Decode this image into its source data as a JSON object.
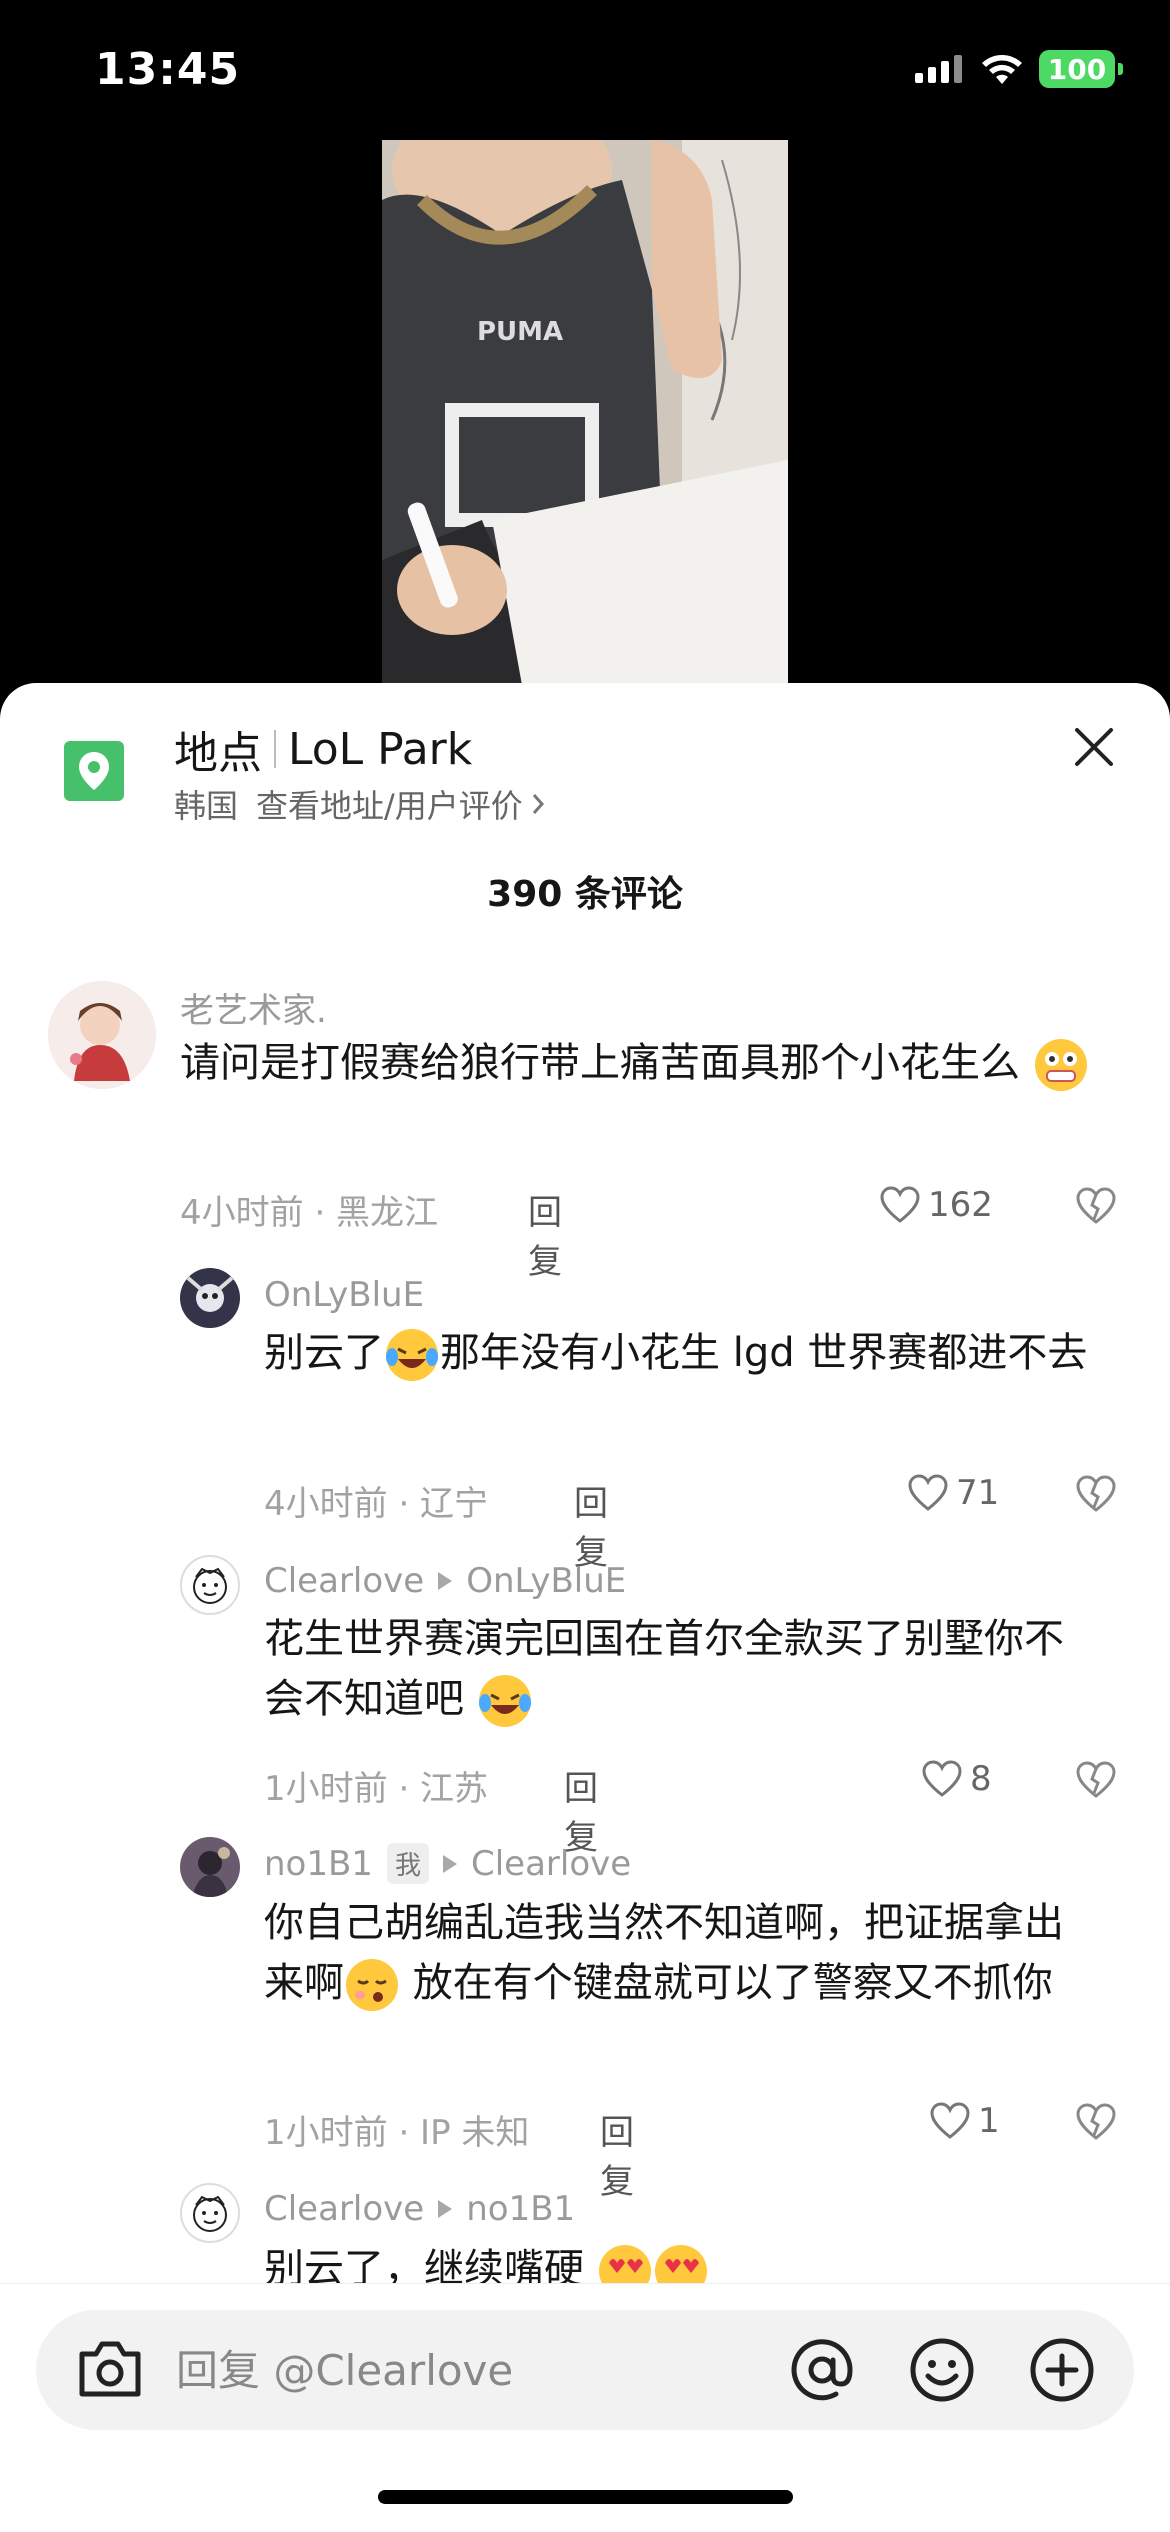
{
  "status_bar": {
    "time": "13:45",
    "battery": "100"
  },
  "location": {
    "label": "地点",
    "name": "LoL Park",
    "country": "韩国",
    "details_link": "查看地址/用户评价"
  },
  "comment_count": "390 条评论",
  "comments": [
    {
      "user": "老艺术家.",
      "text": "请问是打假赛给狼行带上痛苦面具那个小花生么",
      "time_location": "4小时前 · 黑龙江",
      "reply_label": "回复",
      "likes": "162"
    },
    {
      "user": "OnLyBluE",
      "text_a": "别云了",
      "text_b": "那年没有小花生 lgd 世界赛都进不去",
      "time_location": "4小时前 · 辽宁",
      "reply_label": "回复",
      "likes": "71"
    },
    {
      "user": "Clearlove",
      "reply_to": "OnLyBluE",
      "text": "花生世界赛演完回国在首尔全款买了别墅你不会不知道吧",
      "time_location": "1小时前 · 江苏",
      "reply_label": "回复",
      "likes": "8"
    },
    {
      "user": "no1B1",
      "badge": "我",
      "reply_to": "Clearlove",
      "text_a": "你自己胡编乱造我当然不知道啊，把证据拿出来啊",
      "text_b": " 放在有个键盘就可以了警察又不抓你",
      "time_location": "1小时前 · IP 未知",
      "reply_label": "回复",
      "likes": "1"
    },
    {
      "user": "Clearlove",
      "reply_to": "no1B1",
      "text": "别云了，继续嘴硬"
    }
  ],
  "input": {
    "placeholder": "回复 @Clearlove"
  },
  "icons": {
    "location": "map-pin-icon",
    "close": "close-icon",
    "like": "heart-outline-icon",
    "dislike": "broken-heart-icon",
    "camera": "camera-icon",
    "mention": "at-icon",
    "emoji": "smiley-icon",
    "add": "plus-circle-icon"
  },
  "colors": {
    "location_accent": "#46c06a",
    "battery": "#4cd964"
  }
}
